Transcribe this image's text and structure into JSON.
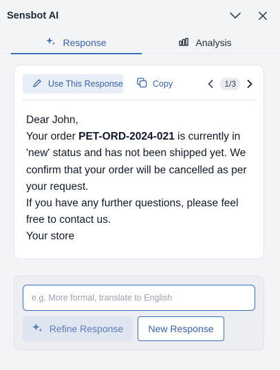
{
  "header": {
    "title": "Sensbot AI",
    "collapse_icon": "chevron-down-icon",
    "close_icon": "close-icon"
  },
  "tabs": [
    {
      "label": "Response",
      "icon": "sparkle-icon",
      "active": true
    },
    {
      "label": "Analysis",
      "icon": "bar-chart-icon",
      "active": false
    }
  ],
  "card": {
    "use_label": "Use This Response",
    "copy_label": "Copy",
    "pager": "1/3",
    "message": {
      "greeting": "Dear John,",
      "line_before_order": "Your order ",
      "order_id": "PET-ORD-2024-021",
      "line_after_order": " is currently in 'new' status and has not been shipped yet. We confirm that your order will be cancelled as per your request.",
      "followup": "If you have any further questions, please feel free to contact us.",
      "signoff": "Your store"
    }
  },
  "refine": {
    "placeholder": "e.g. More formal, translate to English",
    "value": "",
    "refine_label": "Refine Response",
    "new_label": "New Response"
  },
  "colors": {
    "accent": "#3b6fb8",
    "accent_text": "#3b5fa0",
    "background": "#f3f4f6"
  }
}
